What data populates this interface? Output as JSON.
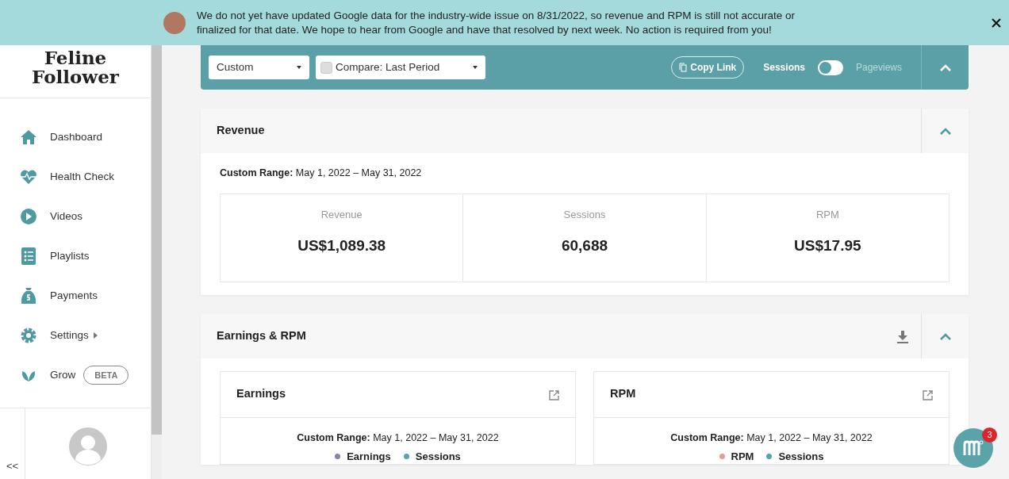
{
  "banner": {
    "message": "We do not yet have updated Google data for the industry-wide issue on 8/31/2022, so revenue and RPM is still not accurate or finalized for that date. We hope to hear from Google and have that resolved by next week.  No action is required from you!"
  },
  "sidebar": {
    "logo": "Feline Follower",
    "items": [
      {
        "label": "Dashboard"
      },
      {
        "label": "Health Check"
      },
      {
        "label": "Videos"
      },
      {
        "label": "Playlists"
      },
      {
        "label": "Payments"
      },
      {
        "label": "Settings",
        "submenu": true
      },
      {
        "label": "Grow",
        "badge": "BETA"
      }
    ],
    "collapse": "<<"
  },
  "toolbar": {
    "range_select": "Custom",
    "compare": {
      "label": "Compare: Last Period",
      "checked": false
    },
    "copy_link": "Copy Link",
    "metric_toggle": {
      "left": "Sessions",
      "right": "Pageviews",
      "on": false
    },
    "expanded": true
  },
  "revenue_card": {
    "title": "Revenue",
    "expanded": true,
    "range_label": "Custom Range:",
    "range": "May 1, 2022 – May 31, 2022",
    "stats": [
      {
        "label": "Revenue",
        "value": "US$1,089.38"
      },
      {
        "label": "Sessions",
        "value": "60,688"
      },
      {
        "label": "RPM",
        "value": "US$17.95"
      }
    ]
  },
  "earnings_card": {
    "title": "Earnings & RPM",
    "expanded": true,
    "panels": [
      {
        "title": "Earnings",
        "range_label": "Custom Range:",
        "range": "May 1, 2022 – May 31, 2022",
        "legend": [
          {
            "label": "Earnings",
            "color": "#8a80a8"
          },
          {
            "label": "Sessions",
            "color": "#5aa3a8"
          }
        ]
      },
      {
        "title": "RPM",
        "range_label": "Custom Range:",
        "range": "May 1, 2022 – May 31, 2022",
        "legend": [
          {
            "label": "RPM",
            "color": "#e39a9a"
          },
          {
            "label": "Sessions",
            "color": "#5aa3a8"
          }
        ]
      }
    ]
  },
  "chat": {
    "badge": "3"
  }
}
